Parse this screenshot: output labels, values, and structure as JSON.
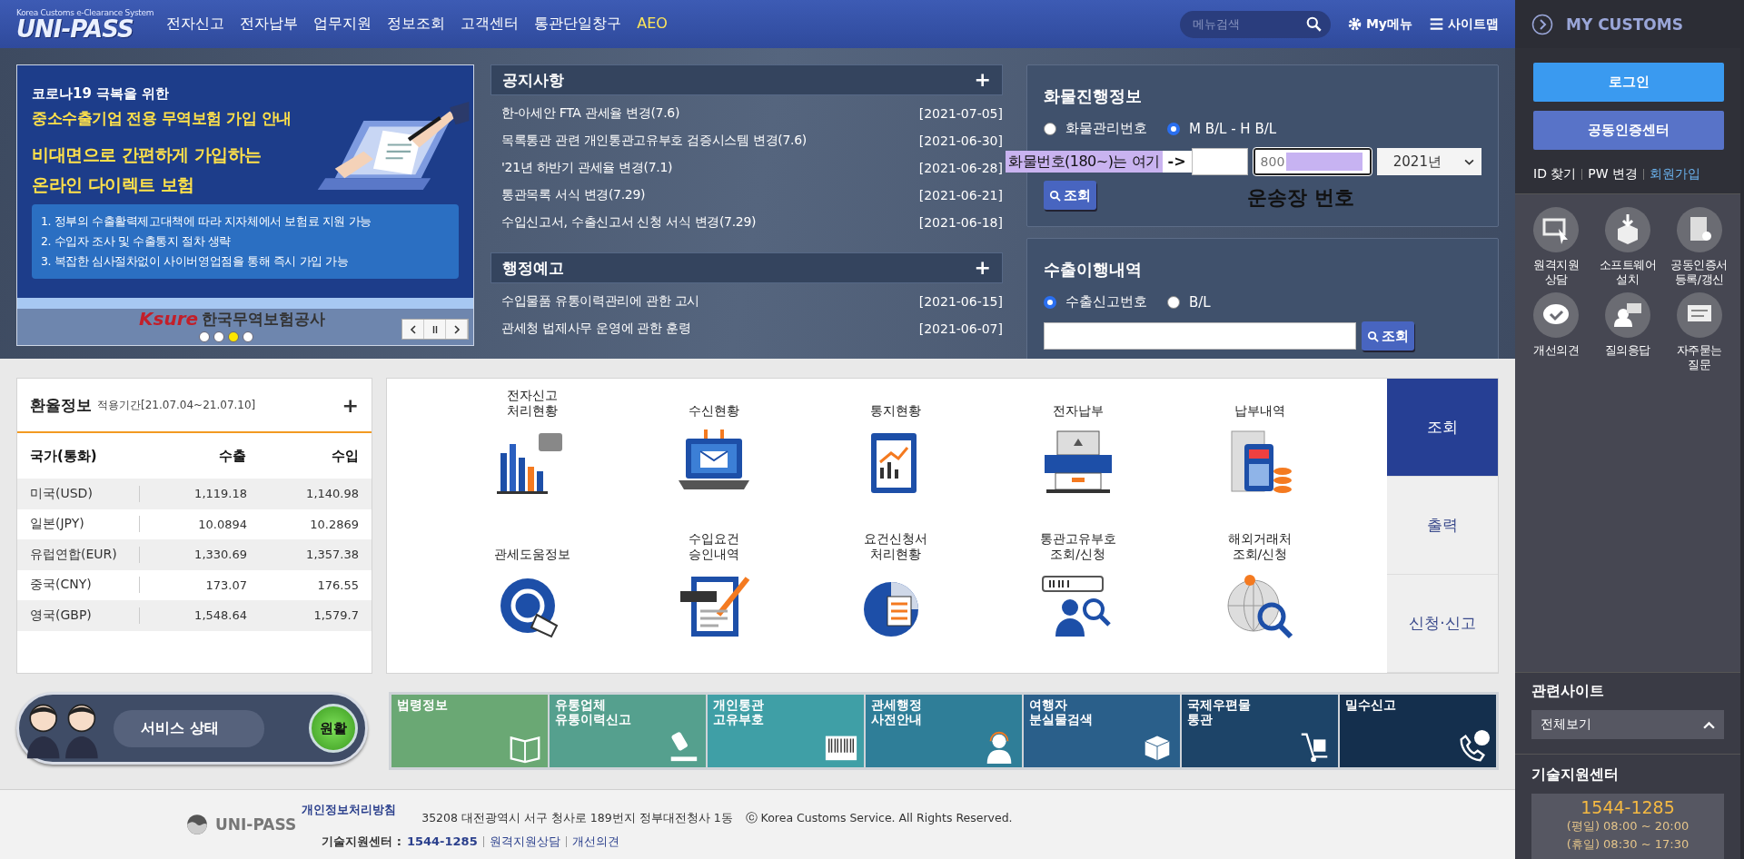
{
  "nav": {
    "logo": "UNI-PASS",
    "logo_subtitle": "Korea Customs e-Clearance System",
    "menu": [
      {
        "label": "전자신고",
        "kind": "plain"
      },
      {
        "label": "전자납부",
        "kind": "plain"
      },
      {
        "label": "업무지원",
        "kind": "plain"
      },
      {
        "label": "정보조회",
        "kind": "plain"
      },
      {
        "label": "고객센터",
        "kind": "plain"
      },
      {
        "label": "통관단일창구",
        "kind": "plain"
      },
      {
        "label": "AEO",
        "kind": "accent"
      }
    ],
    "search": {
      "placeholder": "메뉴검색"
    },
    "my_menu": "My메뉴",
    "sitemap": "사이트맵"
  },
  "banner": {
    "lines": [
      {
        "text": "코로나19 극복을 위한",
        "kind": "small"
      },
      {
        "text": "중소수출기업 전용 무역보험 가입 안내",
        "kind": "yellow"
      },
      {
        "text": "비대면으로 간편하게 가입하는",
        "kind": "yellow"
      },
      {
        "text": "온라인 다이렉트 보험",
        "kind": "yellow"
      }
    ],
    "bullets": [
      "1. 정부의 수출활력제고대책에 따라 지자체에서 보험료 지원 가능",
      "2. 수입자 조사 및 수출통지 절차 생략",
      "3. 복잡한 심사절차없이 사이버영업점을 통해 즉시 가입 가능"
    ],
    "brand": "Ksure",
    "brand_name": "한국무역보험공사",
    "dots": [
      {
        "selected": false
      },
      {
        "selected": false
      },
      {
        "selected": true
      },
      {
        "selected": false
      }
    ]
  },
  "notices": {
    "title": "공지사항",
    "more": "+",
    "items": [
      {
        "title": "한-아세안 FTA 관세율 변경(7.6)",
        "date": "[2021-07-05]"
      },
      {
        "title": "목록통관 관련 개인통관고유부호 검증시스템 변경(7.6)",
        "date": "[2021-06-30]"
      },
      {
        "title": "'21년 하반기 관세율 변경(7.1)",
        "date": "[2021-06-28]"
      },
      {
        "title": "통관목록 서식 변경(7.29)",
        "date": "[2021-06-21]"
      },
      {
        "title": "수입신고서, 수출신고서 신청 서식 변경(7.29)",
        "date": "[2021-06-18]"
      }
    ]
  },
  "announcements": {
    "title": "행정예고",
    "more": "+",
    "items": [
      {
        "title": "수입물품 유통이력관리에 관한 고시",
        "date": "[2021-06-15]"
      },
      {
        "title": "관세청 법제사무 운영에 관한 훈령",
        "date": "[2021-06-07]"
      }
    ]
  },
  "cargo": {
    "title": "화물진행정보",
    "radios": [
      {
        "label": "화물관리번호",
        "selected": false
      },
      {
        "label": "M B/L - H B/L",
        "selected": true
      }
    ],
    "mbl_value": "800",
    "year": "2021년",
    "button": "조회"
  },
  "annotations": {
    "label": "화물번호(180~)는 여기",
    "arrow": "->",
    "note": "운송장 번호"
  },
  "export": {
    "title": "수출이행내역",
    "radios": [
      {
        "label": "수출신고번호",
        "selected": true
      },
      {
        "label": "B/L",
        "selected": false
      }
    ],
    "button": "조회"
  },
  "exchange": {
    "title": "환율정보",
    "period": "적용기간[21.07.04~21.07.10]",
    "more": "+",
    "columns": [
      "국가(통화)",
      "수출",
      "수입"
    ],
    "rows": [
      [
        "미국(USD)",
        "1,119.18",
        "1,140.98"
      ],
      [
        "일본(JPY)",
        "10.0894",
        "10.2869"
      ],
      [
        "유럽연합(EUR)",
        "1,330.69",
        "1,357.38"
      ],
      [
        "중국(CNY)",
        "173.07",
        "176.55"
      ],
      [
        "영국(GBP)",
        "1,548.64",
        "1,579.7"
      ]
    ]
  },
  "services": {
    "items": [
      {
        "label": "전자신고\n처리현황",
        "kind": "bars"
      },
      {
        "label": "수신현황",
        "kind": "mail"
      },
      {
        "label": "통지현황",
        "kind": "clipboard"
      },
      {
        "label": "전자납부",
        "kind": "printer"
      },
      {
        "label": "납부내역",
        "kind": "receipt"
      },
      {
        "label": "관세도움정보",
        "kind": "hand"
      },
      {
        "label": "수입요건\n승인내역",
        "kind": "document"
      },
      {
        "label": "요건신청서\n처리현황",
        "kind": "pie"
      },
      {
        "label": "통관고유부호\n조회/신청",
        "kind": "person"
      },
      {
        "label": "해외거래처\n조회/신청",
        "kind": "globe"
      }
    ],
    "tabs": [
      {
        "label": "조회",
        "selected": true
      },
      {
        "label": "출력",
        "selected": false
      },
      {
        "label": "신청·신고",
        "selected": false
      }
    ]
  },
  "status": {
    "label": "서비스 상태",
    "value": "원활"
  },
  "links": [
    {
      "label": "법령정보",
      "kind": "book",
      "color": "#6aa874"
    },
    {
      "label": "유통업체\n유통이력신고",
      "kind": "stamp",
      "color": "#55a08e"
    },
    {
      "label": "개인통관\n고유부호",
      "kind": "barcode",
      "color": "#3f9fa6"
    },
    {
      "label": "관세행정\n사전안내",
      "kind": "headset",
      "color": "#2f7e98"
    },
    {
      "label": "여행자\n분실물검색",
      "kind": "box",
      "color": "#2a5f8a"
    },
    {
      "label": "국제우편물\n통관",
      "kind": "cart",
      "color": "#1d4468"
    },
    {
      "label": "밀수신고",
      "kind": "phone",
      "color": "#142f4d"
    }
  ],
  "footer": {
    "logo": "UNI-PASS",
    "privacy": "개인정보처리방침",
    "address": "35208 대전광역시 서구 청사로 189번지 정부대전청사 1동",
    "copyright": "ⓒ Korea Customs Service. All Rights Reserved.",
    "support_label": "기술지원센터 :",
    "support_phone": "1544-1285",
    "support_links": [
      "원격지원상담",
      "개선의견"
    ]
  },
  "sidebar": {
    "title": "MY CUSTOMS",
    "login": "로그인",
    "cert_center": "공동인증센터",
    "links": [
      {
        "label": "ID 찾기",
        "kind": "plain"
      },
      {
        "label": "PW 변경",
        "kind": "plain"
      },
      {
        "label": "회원가입",
        "kind": "accent"
      }
    ],
    "quick": [
      {
        "label": "원격지원\n상담",
        "kind": "monitor"
      },
      {
        "label": "소프트웨어\n설치",
        "kind": "box"
      },
      {
        "label": "공동인증서\n등록/갱신",
        "kind": "certificate"
      },
      {
        "label": "개선의견",
        "kind": "chat-check"
      },
      {
        "label": "질의응답",
        "kind": "person-chat"
      },
      {
        "label": "자주묻는\n질문",
        "kind": "chat-lines"
      }
    ],
    "related_title": "관련사이트",
    "related_select": "전체보기",
    "support_title": "기술지원센터",
    "support_phone": "1544-1285",
    "support_hours": [
      "(평일) 08:00 ~ 20:00",
      "(휴일) 08:30 ~ 17:30"
    ]
  }
}
